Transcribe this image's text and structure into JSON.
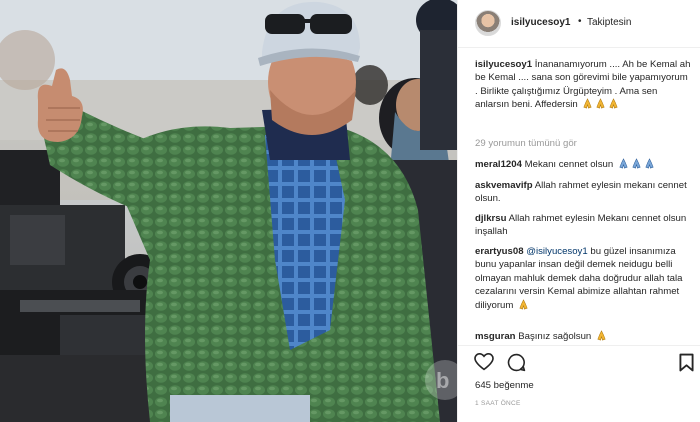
{
  "photo": {
    "alt": "",
    "watermark_letter": "b"
  },
  "header": {
    "username": "isilyucesoy1",
    "separator": "•",
    "follow_status": "Takiptesin"
  },
  "caption": {
    "username": "isilyucesoy1",
    "text": "İnananamıyorum .... Ah be Kemal ah be Kemal .... sana son görevimi bile yapamıyorum . Birlikte çalıştığımız Ürgüpteyim . Ama sen anlarsın beni. Affedersin"
  },
  "view_all_comments": "29 yorumun tümünü gör",
  "comments": [
    {
      "username": "meral1204",
      "text": "Mekanı cennet olsun"
    },
    {
      "username": "askvemavifp",
      "text": "Allah rahmet eylesin mekanı cennet olsun."
    },
    {
      "username": "djlkrsu",
      "text": "Allah rahmet eylesin Mekanı cennet olsun inşallah"
    },
    {
      "username": "erartyus08",
      "mention": "@isilyucesoy1",
      "text": "bu güzel insanımıza bunu yapanlar insan değil demek neidugu belli olmayan mahluk demek daha doğrudur allah tala cezalarını versin Kemal abimize allahtan rahmet diliyorum"
    },
    {
      "username": "msguran",
      "text": "Başınız sağolsun"
    }
  ],
  "likes": "645 beğenme",
  "timestamp": "1 SAAT ÖNCE",
  "colors": {
    "text": "#262626",
    "muted": "#999999",
    "mention": "#003569",
    "border": "#efefef",
    "jacket": "#3d6b3f"
  },
  "icons": [
    "heart-icon",
    "comment-icon",
    "bookmark-icon",
    "praying-hands-icon"
  ]
}
